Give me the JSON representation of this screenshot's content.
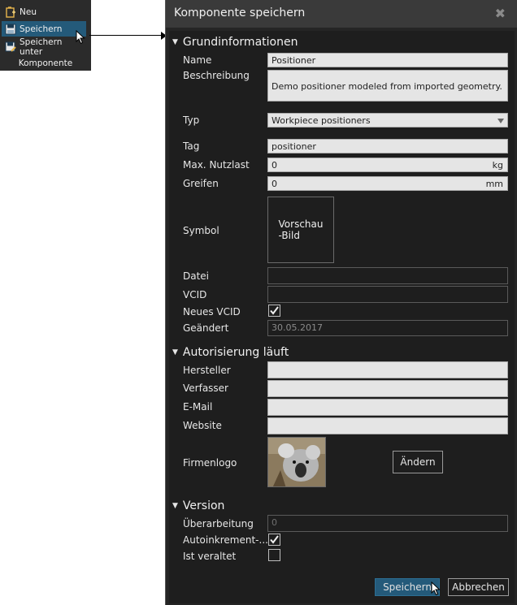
{
  "menu": {
    "items": [
      {
        "label": "Neu",
        "icon": "new-file-icon",
        "active": false
      },
      {
        "label": "Speichern",
        "icon": "save-icon",
        "active": true
      },
      {
        "label": "Speichern unter",
        "icon": "save-as-icon",
        "active": false
      }
    ],
    "caption": "Komponente"
  },
  "dialog": {
    "title": "Komponente speichern",
    "close_glyph": "✖",
    "sections": {
      "basic": "Grundinformationen",
      "auth": "Autorisierung läuft",
      "version": "Version"
    },
    "labels": {
      "name": "Name",
      "description": "Beschreibung",
      "type": "Typ",
      "tag": "Tag",
      "max_payload": "Max. Nutzlast",
      "grip": "Greifen",
      "symbol": "Symbol",
      "file": "Datei",
      "vcid": "VCID",
      "new_vcid": "Neues VCID",
      "modified": "Geändert",
      "manufacturer": "Hersteller",
      "author": "Verfasser",
      "email": "E-Mail",
      "website": "Website",
      "company_logo": "Firmenlogo",
      "revision": "Überarbeitung",
      "auto_increment": "Autoinkrement-...",
      "obsolete": "Ist veraltet"
    },
    "values": {
      "name": "Positioner",
      "description": "Demo positioner modeled from imported geometry.",
      "type": "Workpiece positioners",
      "tag": "positioner",
      "max_payload": "0",
      "max_payload_unit": "kg",
      "grip": "0",
      "grip_unit": "mm",
      "symbol_preview_line1": "Vorschau",
      "symbol_preview_line2": "-Bild",
      "file": "",
      "vcid": "",
      "modified": "30.05.2017",
      "manufacturer": "",
      "author": "",
      "email": "",
      "website": "",
      "revision": "0"
    },
    "checks": {
      "new_vcid": true,
      "auto_increment": true,
      "obsolete": false
    },
    "buttons": {
      "change": "Ändern",
      "save": "Speichern",
      "cancel": "Abbrechen"
    }
  },
  "colors": {
    "accent": "#245a7a",
    "dialog_bg": "#1e1e1e",
    "field_bg": "#e5e5e5"
  }
}
